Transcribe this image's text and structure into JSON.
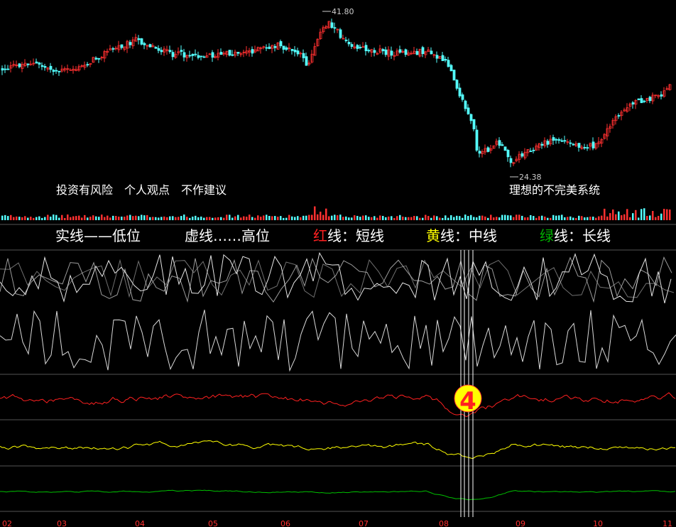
{
  "chart_data": {
    "type": "candlestick",
    "price_annotations": {
      "high_label": "41.80",
      "low_label": "24.38"
    },
    "notes": {
      "left": "投资有风险　个人观点　不作建议",
      "right": "理想的不完美系统"
    },
    "legend": [
      {
        "text": "实线——低位",
        "color": "#ffffff"
      },
      {
        "text": "虚线……高位",
        "color": "#ffffff"
      },
      {
        "prefix": "红",
        "prefix_color": "#ff2020",
        "text": "线：短线",
        "color": "#ffffff"
      },
      {
        "prefix": "黄",
        "prefix_color": "#ffff00",
        "text": "线：中线",
        "color": "#ffffff"
      },
      {
        "prefix": "绿",
        "prefix_color": "#00b000",
        "text": "线：长线",
        "color": "#ffffff"
      }
    ],
    "marker_label": "4",
    "x_ticks": [
      "02",
      "03",
      "04",
      "05",
      "06",
      "07",
      "08",
      "09",
      "10",
      "11"
    ],
    "colors": {
      "up": "#ff3030",
      "down": "#54ffff",
      "short": "#ff2020",
      "mid": "#ffff00",
      "long": "#00c000",
      "grid": "#555555",
      "tick": "#ff3030"
    }
  }
}
